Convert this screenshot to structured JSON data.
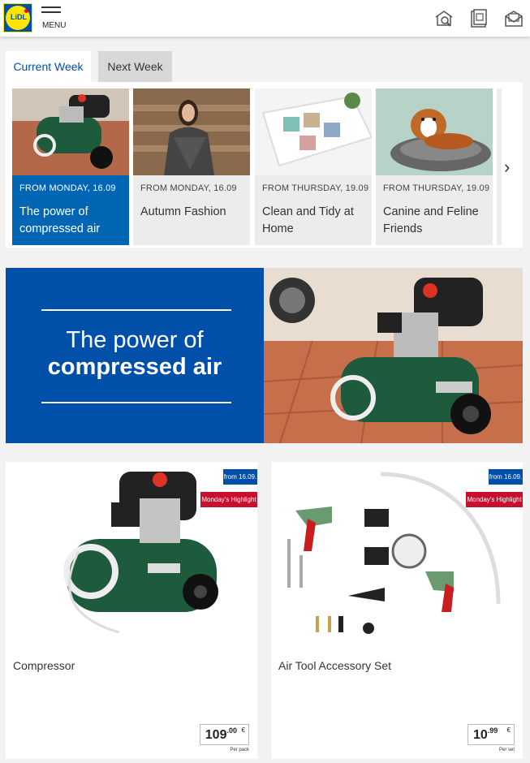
{
  "header": {
    "logo_text": "LiDL",
    "menu_label": "MENU",
    "icons": [
      "store-search-icon",
      "leaflet-icon",
      "newsletter-icon"
    ]
  },
  "tabs": [
    {
      "label": "Current Week",
      "active": true
    },
    {
      "label": "Next Week",
      "active": false
    }
  ],
  "carousel": {
    "items": [
      {
        "date": "FROM MONDAY, 16.09",
        "title": "The power of compressed air",
        "active": true
      },
      {
        "date": "FROM MONDAY, 16.09",
        "title": "Autumn Fashion",
        "active": false
      },
      {
        "date": "FROM THURSDAY, 19.09",
        "title": "Clean and Tidy at Home",
        "active": false
      },
      {
        "date": "FROM THURSDAY, 19.09",
        "title": "Canine and Feline Friends",
        "active": false
      }
    ],
    "next_glyph": "›"
  },
  "hero": {
    "line1": "The power of",
    "line2": "compressed air"
  },
  "products": [
    {
      "name": "Compressor",
      "badge_date": "from 16.09.",
      "badge_highlight": "Monday's Highlight",
      "price_main": "109",
      "price_cents": ".00",
      "currency": "€",
      "price_prefix": "",
      "unit": "Per pack"
    },
    {
      "name": "Air Tool Accessory Set",
      "badge_date": "from 16.09.",
      "badge_highlight": "Monday's Highlight",
      "price_main": "10",
      "price_cents": ".99",
      "currency": "€",
      "price_prefix": "",
      "unit": "Per set"
    }
  ],
  "colors": {
    "brand_blue": "#0050aa",
    "active_card_blue": "#0066b3",
    "highlight_red": "#c8102e",
    "compressor_green": "#1e5a3c"
  }
}
